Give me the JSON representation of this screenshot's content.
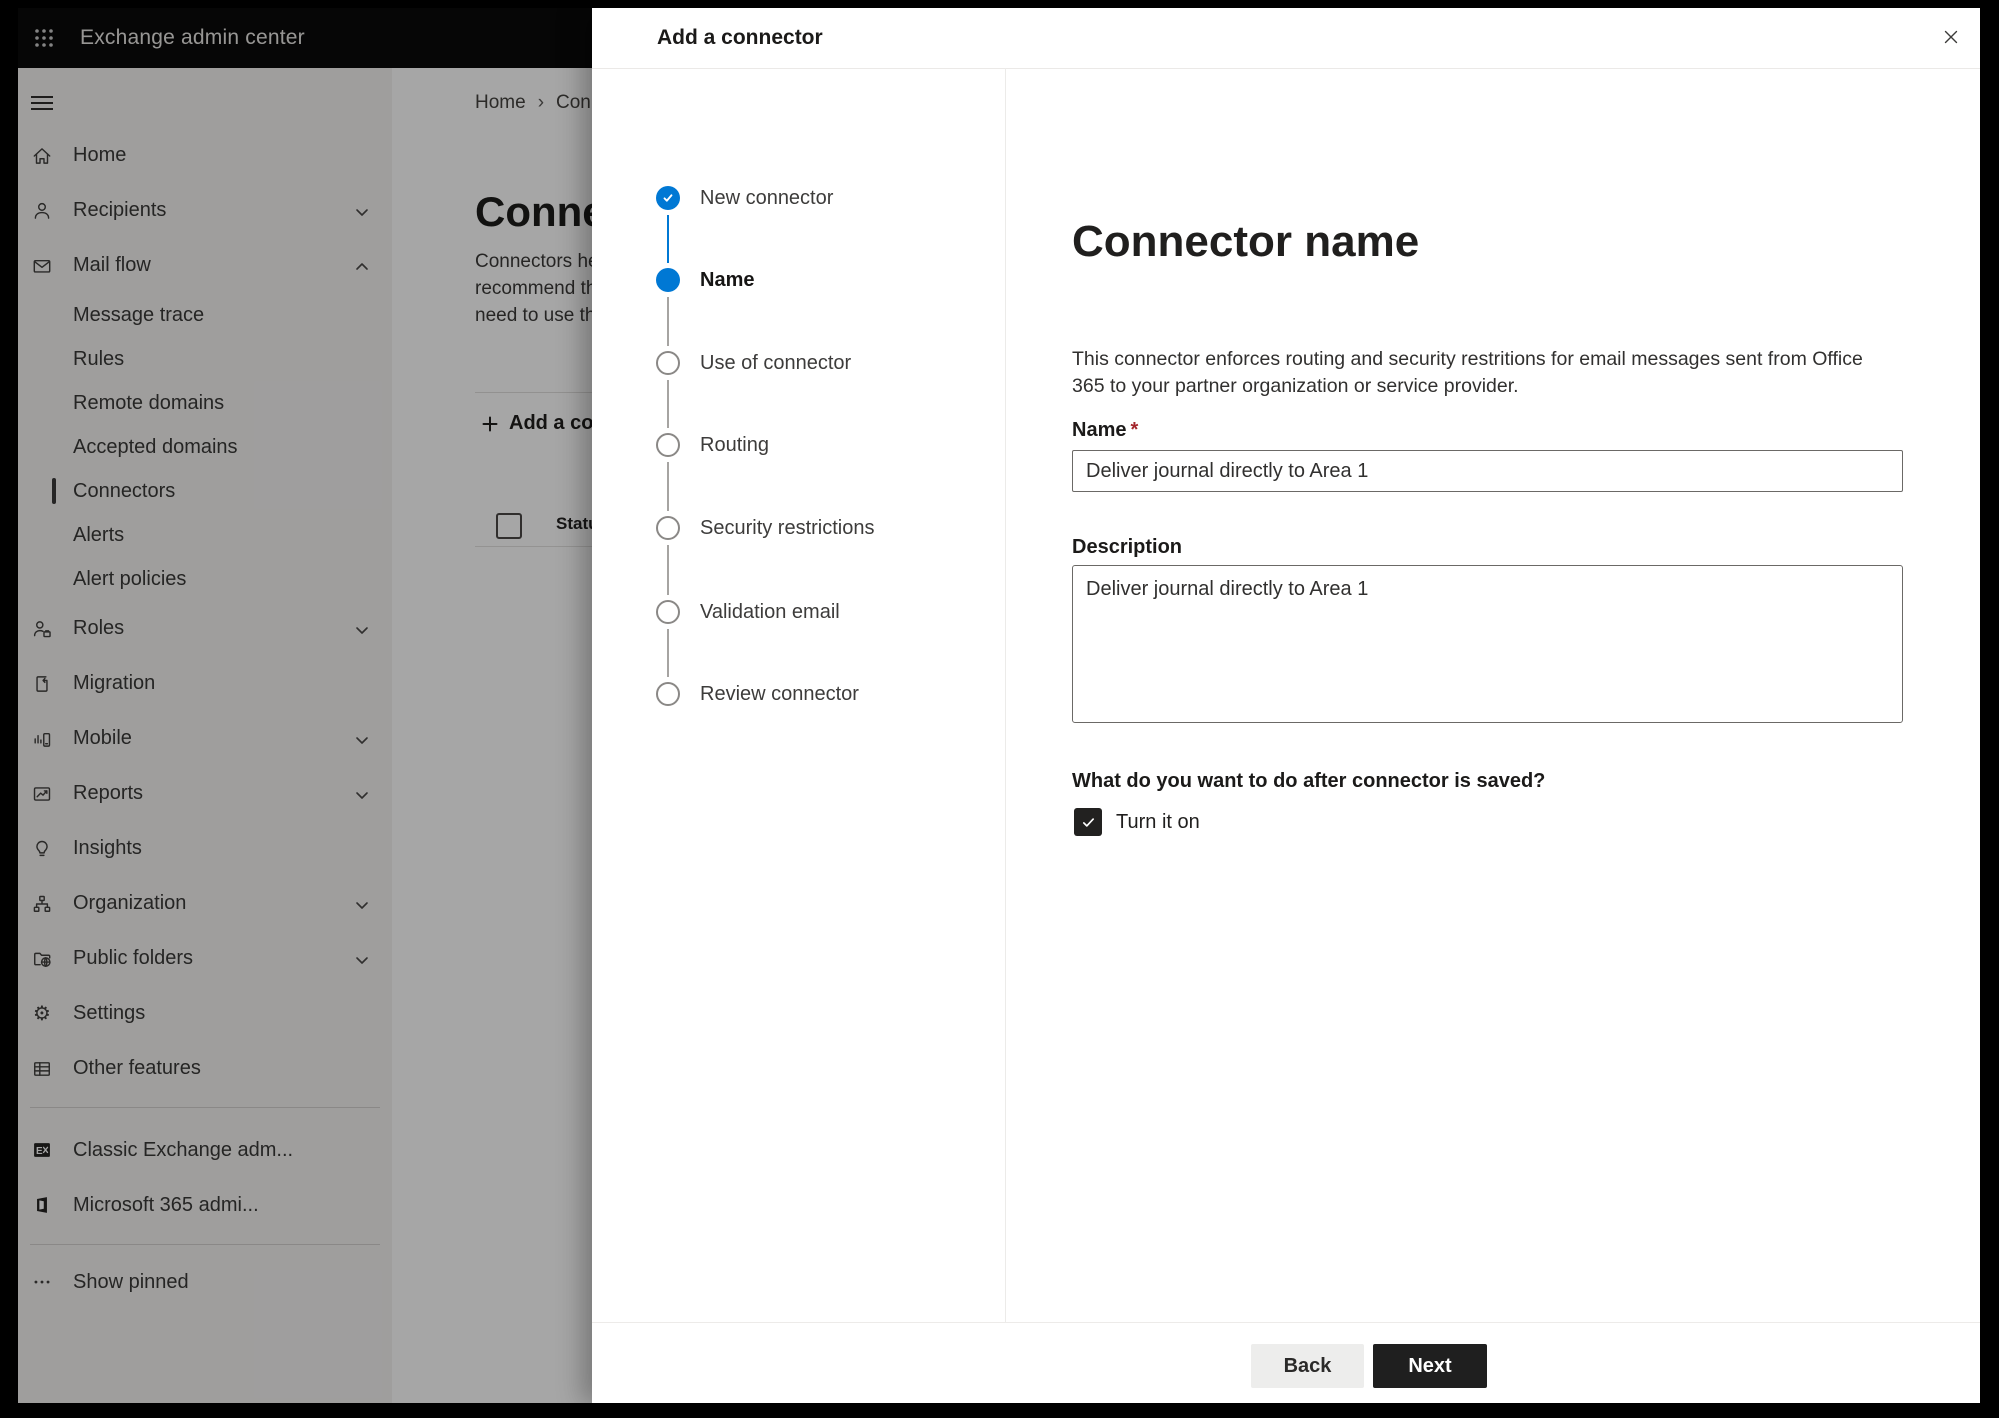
{
  "colors": {
    "accent_blue": "#0078d4",
    "required_red": "#a4262c",
    "next_button": "#1f1f1f",
    "topbar_bg": "#0a0a0a"
  },
  "topbar": {
    "title": "Exchange admin center"
  },
  "sidebar": {
    "items": [
      {
        "label": "Home",
        "icon": "home",
        "level": 1
      },
      {
        "label": "Recipients",
        "icon": "recipients",
        "level": 1,
        "chevron": "down"
      },
      {
        "label": "Mail flow",
        "icon": "mail-flow",
        "level": 1,
        "chevron": "up",
        "expanded": true
      },
      {
        "label": "Message trace",
        "level": 2
      },
      {
        "label": "Rules",
        "level": 2
      },
      {
        "label": "Remote domains",
        "level": 2
      },
      {
        "label": "Accepted domains",
        "level": 2
      },
      {
        "label": "Connectors",
        "level": 2,
        "selected": true
      },
      {
        "label": "Alerts",
        "level": 2
      },
      {
        "label": "Alert policies",
        "level": 2
      },
      {
        "label": "Roles",
        "icon": "roles",
        "level": 1,
        "chevron": "down"
      },
      {
        "label": "Migration",
        "icon": "migration",
        "level": 1
      },
      {
        "label": "Mobile",
        "icon": "mobile",
        "level": 1,
        "chevron": "down"
      },
      {
        "label": "Reports",
        "icon": "reports",
        "level": 1,
        "chevron": "down"
      },
      {
        "label": "Insights",
        "icon": "insights",
        "level": 1
      },
      {
        "label": "Organization",
        "icon": "organization",
        "level": 1,
        "chevron": "down"
      },
      {
        "label": "Public folders",
        "icon": "public-folders",
        "level": 1,
        "chevron": "down"
      },
      {
        "label": "Settings",
        "icon": "settings",
        "level": 1
      },
      {
        "label": "Other features",
        "icon": "other-features",
        "level": 1
      }
    ],
    "footer_items": [
      {
        "label": "Classic Exchange adm...",
        "icon": "classic-exchange"
      },
      {
        "label": "Microsoft 365 admi...",
        "icon": "microsoft-365"
      }
    ],
    "show_pinned_label": "Show pinned"
  },
  "main": {
    "breadcrumb": [
      "Home",
      "Conne"
    ],
    "heading": "Connect",
    "intro_lines": [
      "Connectors help",
      "recommend that",
      "need to use ther"
    ],
    "add_button_label": "Add a conn",
    "status_header": "Status"
  },
  "dialog": {
    "title": "Add a connector",
    "steps": [
      {
        "label": "New connector",
        "state": "done"
      },
      {
        "label": "Name",
        "state": "active"
      },
      {
        "label": "Use of connector",
        "state": "todo"
      },
      {
        "label": "Routing",
        "state": "todo"
      },
      {
        "label": "Security restrictions",
        "state": "todo"
      },
      {
        "label": "Validation email",
        "state": "todo"
      },
      {
        "label": "Review connector",
        "state": "todo"
      }
    ],
    "page": {
      "heading": "Connector name",
      "description": "This connector enforces routing and security restritions for email messages sent from Office 365 to your partner organization or service provider.",
      "name_label": "Name",
      "required_marker": "*",
      "name_value": "Deliver journal directly to Area 1",
      "description_label": "Description",
      "description_value": "Deliver journal directly to Area 1",
      "after_save_question": "What do you want to do after connector is saved?",
      "turn_on_label": "Turn it on",
      "turn_on_checked": true
    },
    "footer": {
      "back_label": "Back",
      "next_label": "Next"
    }
  }
}
